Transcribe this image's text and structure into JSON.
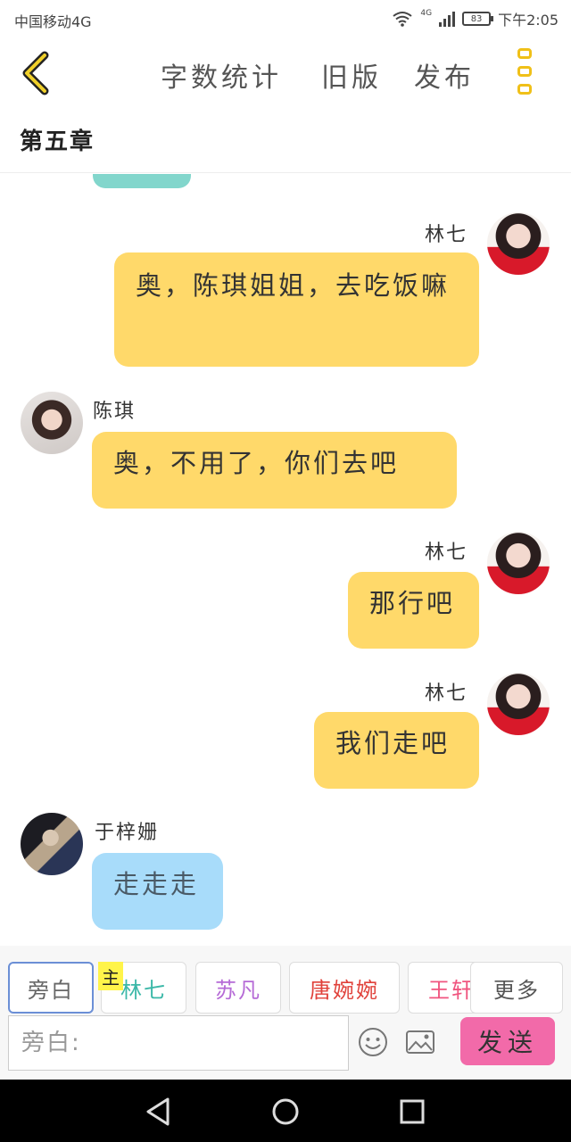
{
  "status_bar": {
    "carrier": "中国移动4G",
    "network": "4G",
    "battery": "83",
    "time": "下午2:05"
  },
  "header": {
    "actions": [
      "字数统计",
      "旧版",
      "发布"
    ]
  },
  "chapter_title": "第五章",
  "messages": [
    {
      "speaker": "林七",
      "side": "right",
      "avatar": "lin",
      "text": "奥，陈琪姐姐，去吃饭嘛"
    },
    {
      "speaker": "陈琪",
      "side": "left",
      "avatar": "chen",
      "text": "奥，不用了，你们去吧"
    },
    {
      "speaker": "林七",
      "side": "right",
      "avatar": "lin",
      "text": "那行吧"
    },
    {
      "speaker": "林七",
      "side": "right",
      "avatar": "lin",
      "text": "我们走吧"
    },
    {
      "speaker": "于梓姗",
      "side": "left",
      "avatar": "yu",
      "text": "走走走"
    }
  ],
  "roles": [
    {
      "label": "旁白",
      "color": "#666666"
    },
    {
      "label": "林七",
      "color": "#3bb8a8"
    },
    {
      "label": "苏凡",
      "color": "#b56ad6"
    },
    {
      "label": "唐婉婉",
      "color": "#e0413a"
    },
    {
      "label": "王轩",
      "color": "#f0557f"
    },
    {
      "label": "更多",
      "color": "#666666"
    }
  ],
  "main_tag": "主",
  "input": {
    "placeholder": "旁白:"
  },
  "send_label": "发送"
}
